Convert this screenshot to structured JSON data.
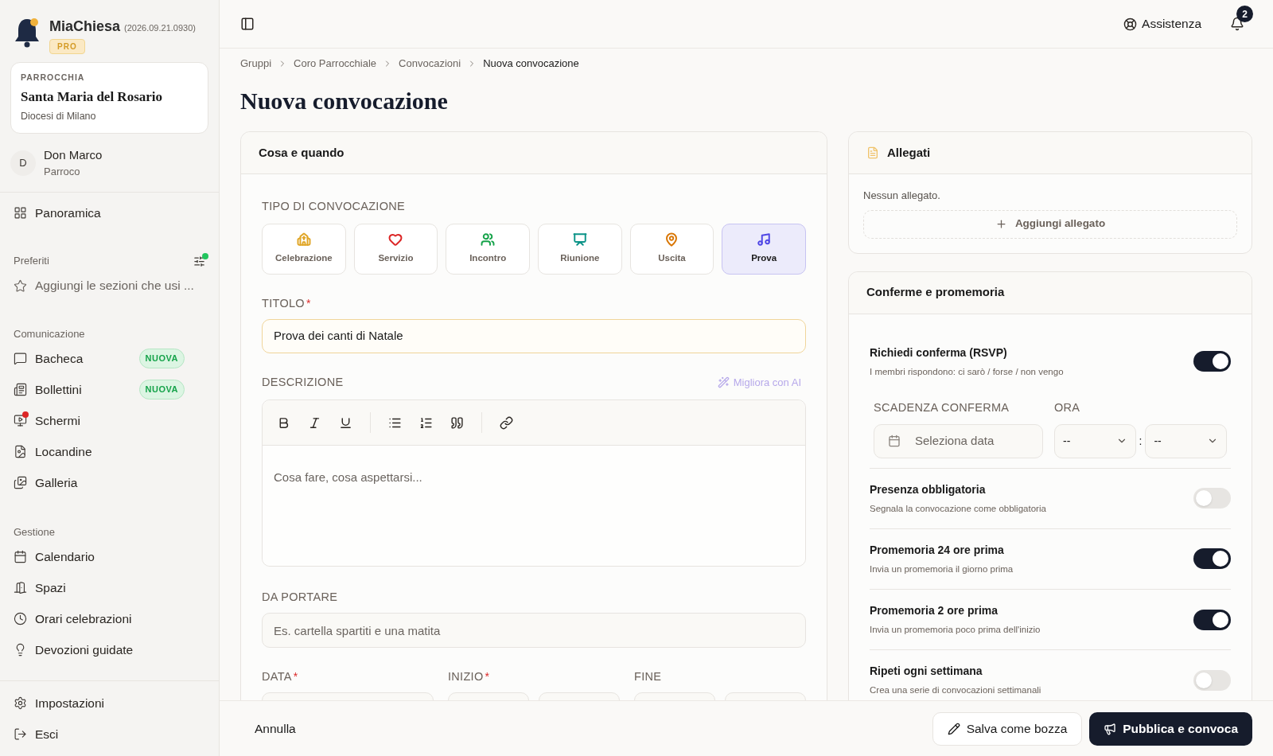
{
  "app": {
    "name": "MiaChiesa",
    "version": "(2026.09.21.0930)",
    "plan": "PRO"
  },
  "parish": {
    "label": "PARROCCHIA",
    "name": "Santa Maria del Rosario",
    "diocese": "Diocesi di Milano"
  },
  "user": {
    "initial": "D",
    "name": "Don Marco",
    "role": "Parroco"
  },
  "sidebar": {
    "top": [
      {
        "label": "Panoramica"
      }
    ],
    "favorites": {
      "title": "Preferiti",
      "placeholder": "Aggiungi le sezioni che usi ..."
    },
    "sections": [
      {
        "title": "Comunicazione",
        "items": [
          {
            "label": "Bacheca",
            "badge": "NUOVA",
            "dot": false
          },
          {
            "label": "Bollettini",
            "badge": "NUOVA",
            "dot": false
          },
          {
            "label": "Schermi",
            "dot": true
          },
          {
            "label": "Locandine",
            "dot": false
          },
          {
            "label": "Galleria",
            "dot": false
          }
        ]
      },
      {
        "title": "Gestione",
        "items": [
          {
            "label": "Calendario",
            "dot": false
          },
          {
            "label": "Spazi",
            "dot": false
          },
          {
            "label": "Orari celebrazioni",
            "dot": false
          },
          {
            "label": "Devozioni guidate",
            "dot": false
          }
        ]
      }
    ],
    "bottom": [
      {
        "label": "Impostazioni"
      },
      {
        "label": "Esci"
      }
    ]
  },
  "header": {
    "help": "Assistenza",
    "notifications": "2"
  },
  "breadcrumb": [
    {
      "label": "Gruppi"
    },
    {
      "label": "Coro Parrocchiale"
    },
    {
      "label": "Convocazioni"
    },
    {
      "label": "Nuova convocazione"
    }
  ],
  "title": "Nuova convocazione",
  "form": {
    "title": "Cosa e quando",
    "type_label": "TIPO DI CONVOCAZIONE",
    "types": [
      {
        "label": "Celebrazione",
        "color": "#e0a526",
        "selected": false
      },
      {
        "label": "Servizio",
        "color": "#dc2626",
        "selected": false
      },
      {
        "label": "Incontro",
        "color": "#16a34a",
        "selected": false
      },
      {
        "label": "Riunione",
        "color": "#0d9488",
        "selected": false
      },
      {
        "label": "Uscita",
        "color": "#d97706",
        "selected": false
      },
      {
        "label": "Prova",
        "color": "#4f46e5",
        "selected": true
      }
    ],
    "title_label": "TITOLO",
    "title_required": "*",
    "title_value": "Prova dei canti di Natale",
    "description_label": "DESCRIZIONE",
    "ai_button": "Migliora con AI",
    "description_placeholder": "Cosa fare, cosa aspettarsi...",
    "bring_label": "DA PORTARE",
    "bring_placeholder": "Es. cartella spartiti e una matita",
    "date_label": "DATA",
    "start_label": "INIZIO",
    "end_label": "FINE",
    "required": "*"
  },
  "attachments": {
    "title": "Allegati",
    "empty": "Nessun allegato.",
    "add": "Aggiungi allegato"
  },
  "reminders": {
    "title": "Conferme e promemoria",
    "options": [
      {
        "title": "Richiedi conferma (RSVP)",
        "description": "I membri rispondono: ci sarò / forse / non vengo",
        "on": true,
        "deadline": {
          "label": "SCADENZA CONFERMA",
          "placeholder": "Seleziona data",
          "time_label": "ORA",
          "hour": "--",
          "minute": "--",
          "separator": ":"
        }
      },
      {
        "title": "Presenza obbligatoria",
        "description": "Segnala la convocazione come obbligatoria",
        "on": false
      },
      {
        "title": "Promemoria 24 ore prima",
        "description": "Invia un promemoria il giorno prima",
        "on": true
      },
      {
        "title": "Promemoria 2 ore prima",
        "description": "Invia un promemoria poco prima dell'inizio",
        "on": true
      },
      {
        "title": "Ripeti ogni settimana",
        "description": "Crea una serie di convocazioni settimanali",
        "on": false
      }
    ]
  },
  "footer": {
    "cancel": "Annulla",
    "draft": "Salva come bozza",
    "publish": "Pubblica e convoca"
  }
}
